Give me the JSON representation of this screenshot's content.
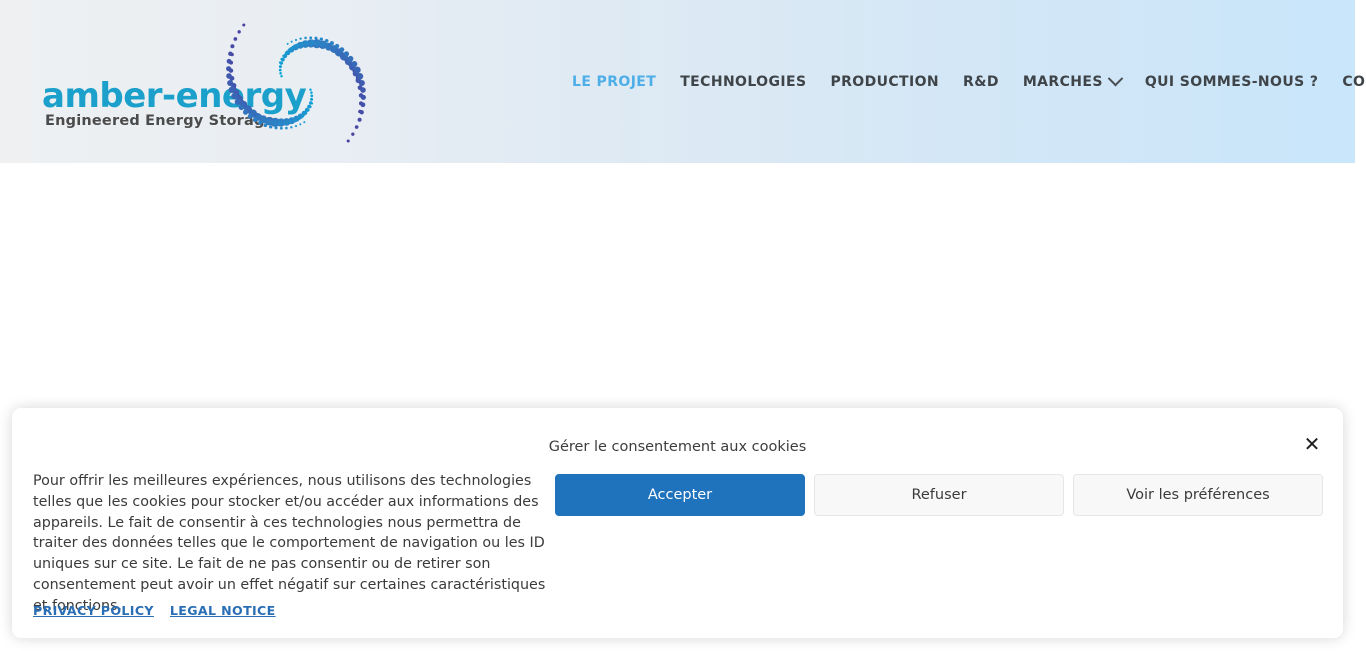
{
  "header": {
    "logo": {
      "wordmark": "amber-energy",
      "tagline": "Engineered Energy Storage",
      "wordmark_color": "#1aa0ca",
      "swirl_colors": [
        "#4a3f9e",
        "#3f5bb0",
        "#2e7fc4",
        "#1c97d0",
        "#00a8d8"
      ]
    },
    "gradient_from": "#eef0f2",
    "gradient_to": "#c9e6fa",
    "nav": [
      {
        "label": "LE PROJET",
        "active": true,
        "has_dropdown": false
      },
      {
        "label": "TECHNOLOGIES",
        "active": false,
        "has_dropdown": false
      },
      {
        "label": "PRODUCTION",
        "active": false,
        "has_dropdown": false
      },
      {
        "label": "R&D",
        "active": false,
        "has_dropdown": false
      },
      {
        "label": "MARCHES",
        "active": false,
        "has_dropdown": true
      },
      {
        "label": "QUI SOMMES-NOUS ?",
        "active": false,
        "has_dropdown": false
      },
      {
        "label": "CONTACT",
        "active": false,
        "has_dropdown": false
      }
    ],
    "active_nav_color": "#4daee8",
    "nav_color": "#3f4448",
    "language": {
      "flag": "fr-flag-icon",
      "has_dropdown": true
    }
  },
  "cookie_banner": {
    "title": "Gérer le consentement aux cookies",
    "close_label": "✕",
    "description": "Pour offrir les meilleures expériences, nous utilisons des technologies telles que les cookies pour stocker et/ou accéder aux informations des appareils. Le fait de consentir à ces technologies nous permettra de traiter des données telles que le comportement de navigation ou les ID uniques sur ce site. Le fait de ne pas consentir ou de retirer son consentement peut avoir un effet négatif sur certaines caractéristiques et fonctions.",
    "buttons": {
      "accept": "Accepter",
      "refuse": "Refuser",
      "preferences": "Voir les préférences"
    },
    "links": [
      {
        "label": "PRIVACY POLICY"
      },
      {
        "label": "LEGAL NOTICE"
      }
    ],
    "accent_color": "#1f73bd",
    "link_color": "#2a6fb5"
  }
}
